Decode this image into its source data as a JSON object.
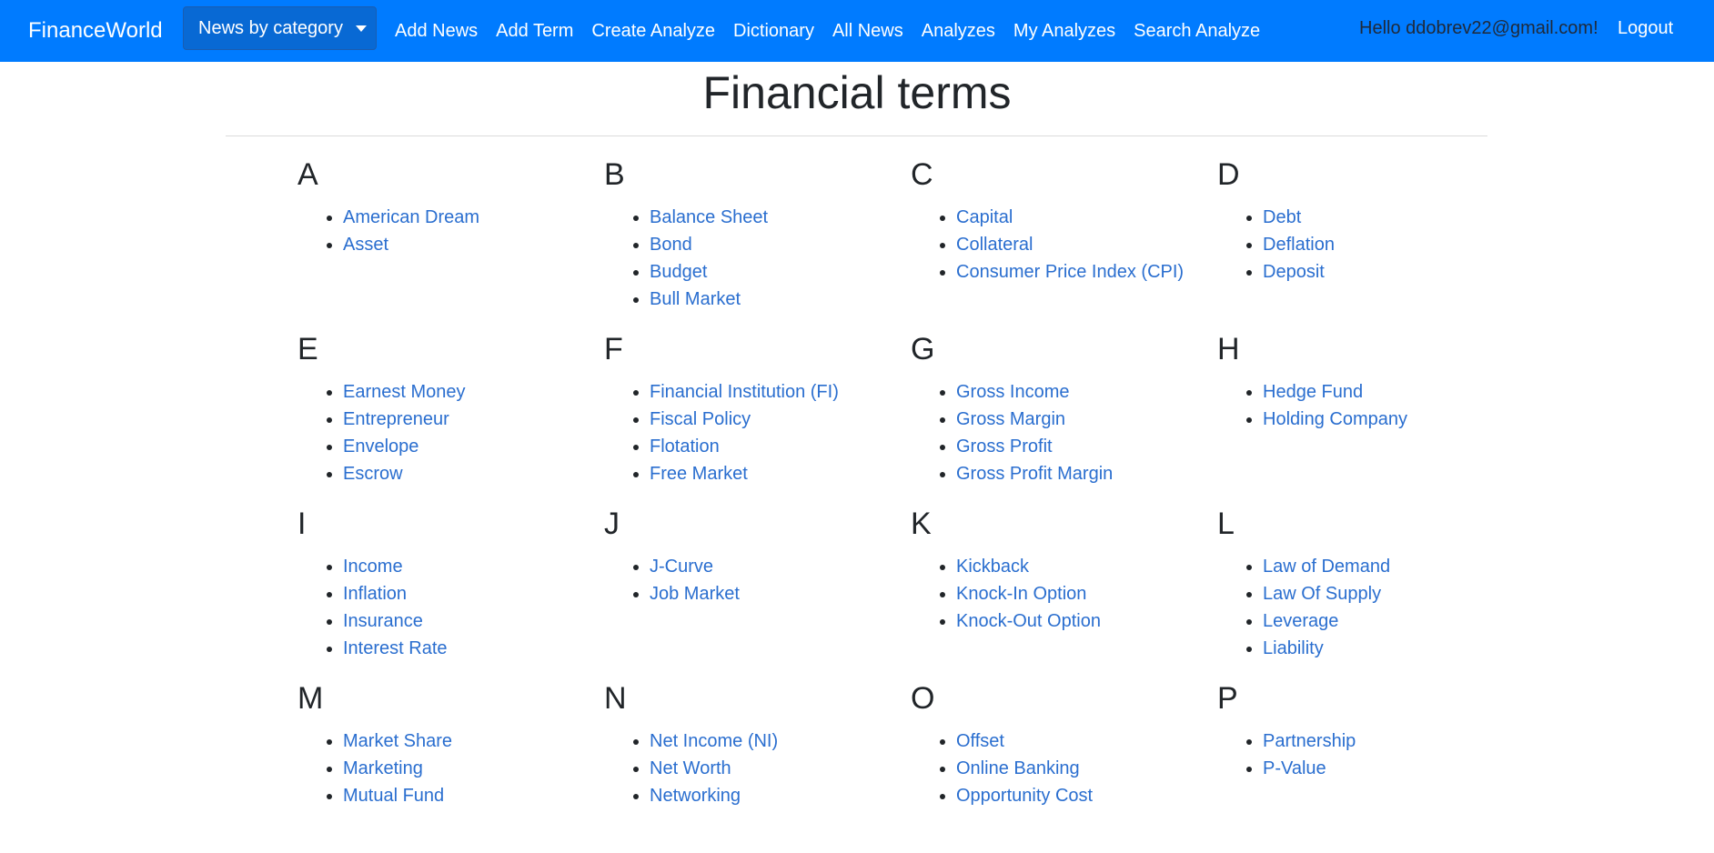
{
  "navbar": {
    "brand": "FinanceWorld",
    "dropdown_label": "News by category",
    "links": [
      "Add News",
      "Add Term",
      "Create Analyze",
      "Dictionary",
      "All News",
      "Analyzes",
      "My Analyzes",
      "Search Analyze"
    ],
    "greeting": "Hello ddobrev22@gmail.com!",
    "logout": "Logout"
  },
  "page": {
    "title": "Financial terms"
  },
  "groups": [
    {
      "letter": "A",
      "terms": [
        "American Dream",
        "Asset"
      ]
    },
    {
      "letter": "B",
      "terms": [
        "Balance Sheet",
        "Bond",
        "Budget",
        "Bull Market"
      ]
    },
    {
      "letter": "C",
      "terms": [
        "Capital",
        "Collateral",
        "Consumer Price Index (CPI)"
      ]
    },
    {
      "letter": "D",
      "terms": [
        "Debt",
        "Deflation",
        "Deposit"
      ]
    },
    {
      "letter": "E",
      "terms": [
        "Earnest Money",
        "Entrepreneur",
        "Envelope",
        "Escrow"
      ]
    },
    {
      "letter": "F",
      "terms": [
        "Financial Institution (FI)",
        "Fiscal Policy",
        "Flotation",
        "Free Market"
      ]
    },
    {
      "letter": "G",
      "terms": [
        "Gross Income",
        "Gross Margin",
        "Gross Profit",
        "Gross Profit Margin"
      ]
    },
    {
      "letter": "H",
      "terms": [
        "Hedge Fund",
        "Holding Company"
      ]
    },
    {
      "letter": "I",
      "terms": [
        "Income",
        "Inflation",
        "Insurance",
        "Interest Rate"
      ]
    },
    {
      "letter": "J",
      "terms": [
        "J-Curve",
        "Job Market"
      ]
    },
    {
      "letter": "K",
      "terms": [
        "Kickback",
        "Knock-In Option",
        "Knock-Out Option"
      ]
    },
    {
      "letter": "L",
      "terms": [
        "Law of Demand",
        "Law Of Supply",
        "Leverage",
        "Liability"
      ]
    },
    {
      "letter": "M",
      "terms": [
        "Market Share",
        "Marketing",
        "Mutual Fund"
      ]
    },
    {
      "letter": "N",
      "terms": [
        "Net Income (NI)",
        "Net Worth",
        "Networking"
      ]
    },
    {
      "letter": "O",
      "terms": [
        "Offset",
        "Online Banking",
        "Opportunity Cost"
      ]
    },
    {
      "letter": "P",
      "terms": [
        "Partnership",
        "P-Value"
      ]
    }
  ],
  "colors": {
    "navbar_bg": "#007bff",
    "link": "#2a6ecf",
    "text": "#212529"
  }
}
